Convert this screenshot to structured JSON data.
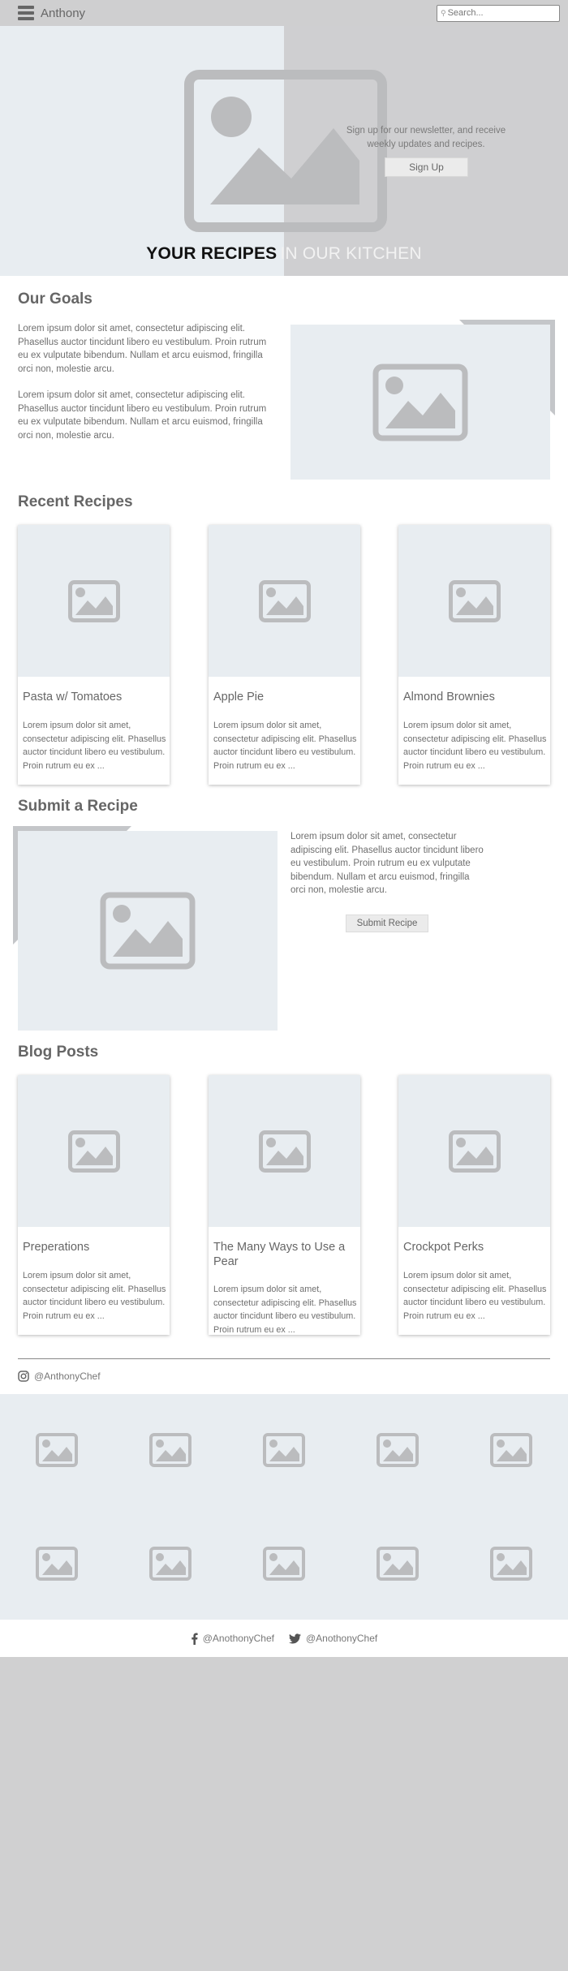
{
  "header": {
    "brand": "Anthony",
    "search_placeholder": "Search..."
  },
  "hero": {
    "newsletter_text": "Sign up for our newsletter, and receive weekly updates and recipes.",
    "signup_label": "Sign Up",
    "title_bold": "YOUR RECIPES",
    "title_light": "IN OUR KITCHEN"
  },
  "goals": {
    "title": "Our Goals",
    "paragraph1": "Lorem ipsum dolor sit amet, consectetur adipiscing elit. Phasellus auctor tincidunt libero eu vestibulum. Proin rutrum eu ex vulputate bibendum. Nullam et arcu euismod, fringilla orci non, molestie arcu.",
    "paragraph2": "Lorem ipsum dolor sit amet, consectetur adipiscing elit. Phasellus auctor tincidunt libero eu vestibulum. Proin rutrum eu ex vulputate bibendum. Nullam et arcu euismod, fringilla orci non, molestie arcu."
  },
  "recent": {
    "title": "Recent Recipes",
    "cards": [
      {
        "title": "Pasta w/ Tomatoes",
        "text": "Lorem ipsum dolor sit amet, consectetur adipiscing elit. Phasellus auctor tincidunt libero eu vestibulum. Proin rutrum eu ex ..."
      },
      {
        "title": "Apple Pie",
        "text": "Lorem ipsum dolor sit amet, consectetur adipiscing elit. Phasellus auctor tincidunt libero eu vestibulum. Proin rutrum eu ex ..."
      },
      {
        "title": "Almond Brownies",
        "text": "Lorem ipsum dolor sit amet, consectetur adipiscing elit. Phasellus auctor tincidunt libero eu vestibulum. Proin rutrum eu ex ..."
      }
    ]
  },
  "submit": {
    "title": "Submit a Recipe",
    "text": "Lorem ipsum dolor sit amet, consectetur adipiscing elit. Phasellus auctor tincidunt libero eu vestibulum. Proin rutrum eu ex vulputate bibendum. Nullam et arcu euismod, fringilla orci non, molestie arcu.",
    "button_label": "Submit Recipe"
  },
  "blog": {
    "title": "Blog Posts",
    "cards": [
      {
        "title": "Preperations",
        "text": "Lorem ipsum dolor sit amet, consectetur adipiscing elit. Phasellus auctor tincidunt libero eu vestibulum. Proin rutrum eu ex ..."
      },
      {
        "title": "The Many Ways to Use a Pear",
        "text": "Lorem ipsum dolor sit amet, consectetur adipiscing elit. Phasellus auctor tincidunt libero eu vestibulum. Proin rutrum eu ex ..."
      },
      {
        "title": "Crockpot Perks",
        "text": "Lorem ipsum dolor sit amet, consectetur adipiscing elit. Phasellus auctor tincidunt libero eu vestibulum. Proin rutrum eu ex ..."
      }
    ]
  },
  "instagram": {
    "handle": "@AnthonyChef",
    "icon": "instagram-icon"
  },
  "footer": {
    "facebook_handle": "@AnothonyChef",
    "twitter_handle": "@AnothonyChef"
  },
  "colors": {
    "placeholder_bg": "#e8edf1",
    "placeholder_icon": "#bbbcbe",
    "header_bg": "#cfcfd0",
    "page_bg": "#d0d0d1"
  }
}
